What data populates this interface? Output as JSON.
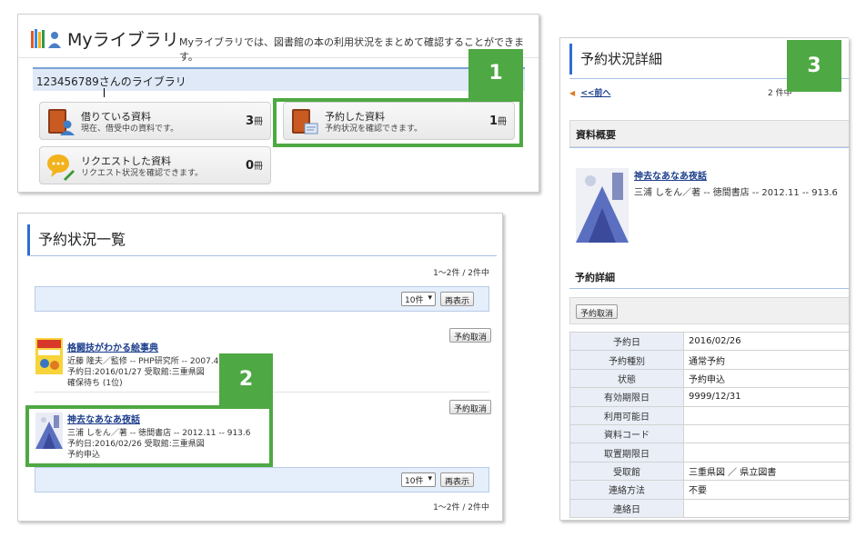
{
  "colors": {
    "accent_green": "#4ea843",
    "accent_blue": "#2d6fd0",
    "link": "#1a3c8c"
  },
  "mylibrary": {
    "title": "Myライブラリ",
    "description": "Myライブラリでは、図書館の本の利用状況をまとめて確認することができます。",
    "user_id": "123456789",
    "user_suffix": "さんのライブラリ",
    "tiles": [
      {
        "name": "借りている資料",
        "sub": "現在、借受中の資料です。",
        "count": "3",
        "unit": "冊",
        "icon": "borrowed-books-icon"
      },
      {
        "name": "予約した資料",
        "sub": "予約状況を確認できます。",
        "count": "1",
        "unit": "冊",
        "icon": "reserved-books-icon"
      },
      {
        "name": "リクエストした資料",
        "sub": "リクエスト状況を確認できます。",
        "count": "0",
        "unit": "冊",
        "icon": "request-chat-icon"
      }
    ]
  },
  "badges": [
    "1",
    "2",
    "3"
  ],
  "reservation_list": {
    "title": "予約状況一覧",
    "count_top": "1～2件 / 2件中",
    "count_bottom": "1～2件 / 2件中",
    "per_page": "10件",
    "show_button": "再表示",
    "items": [
      {
        "title": "格闘技がわかる絵事典",
        "author": "近藤 隆夫／監修 -- PHP研究所 -- 2007.4 --",
        "reserved": "予約日:2016/01/27 受取館:三重県図",
        "status": "確保待ち (1位)",
        "cancel": "予約取消"
      },
      {
        "title": "神去なあなあ夜話",
        "author": "三浦 しをん／著 -- 徳間書店 -- 2012.11 -- 913.6",
        "reserved": "予約日:2016/02/26 受取館:三重県図",
        "status": "予約申込",
        "cancel": "予約取消"
      }
    ]
  },
  "reservation_detail": {
    "title": "予約状況詳細",
    "prev_link": "<<前へ",
    "paging": "2 件中",
    "summary_heading": "資料概要",
    "book_title": "神去なあなあ夜話",
    "book_info": "三浦 しをん／著 -- 徳間書店 -- 2012.11 -- 913.6",
    "detail_heading": "予約詳細",
    "cancel_button": "予約取消",
    "rows": [
      {
        "key": "予約日",
        "value": "2016/02/26"
      },
      {
        "key": "予約種別",
        "value": "通常予約"
      },
      {
        "key": "状態",
        "value": "予約申込"
      },
      {
        "key": "有効期限日",
        "value": "9999/12/31"
      },
      {
        "key": "利用可能日",
        "value": ""
      },
      {
        "key": "資料コード",
        "value": ""
      },
      {
        "key": "取置期限日",
        "value": ""
      },
      {
        "key": "受取館",
        "value": "三重県図 ／ 県立図書"
      },
      {
        "key": "連絡方法",
        "value": "不要"
      },
      {
        "key": "連絡日",
        "value": ""
      }
    ]
  }
}
